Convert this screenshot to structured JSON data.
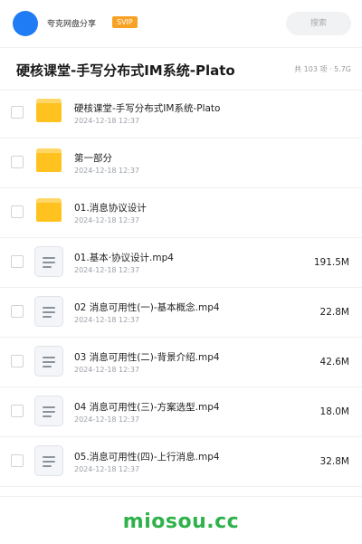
{
  "header": {
    "owner": "夸克网盘分享",
    "badge": "SVIP",
    "search_placeholder": "搜索"
  },
  "folder": {
    "title": "硬核课堂-手写分布式IM系统-Plato",
    "meta": "共 103 项 · 5.7G"
  },
  "items": [
    {
      "type": "folder",
      "name": "硬核课堂-手写分布式IM系统-Plato",
      "date": "2024-12-18 12:37",
      "size": ""
    },
    {
      "type": "folder",
      "name": "第一部分",
      "date": "2024-12-18 12:37",
      "size": ""
    },
    {
      "type": "folder",
      "name": "01.消息协议设计",
      "date": "2024-12-18 12:37",
      "size": ""
    },
    {
      "type": "file",
      "name": "01.基本·协议设计.mp4",
      "date": "2024-12-18 12:37",
      "size": "191.5M"
    },
    {
      "type": "file",
      "name": "02 消息可用性(一)-基本概念.mp4",
      "date": "2024-12-18 12:37",
      "size": "22.8M"
    },
    {
      "type": "file",
      "name": "03 消息可用性(二)-背景介绍.mp4",
      "date": "2024-12-18 12:37",
      "size": "42.6M"
    },
    {
      "type": "file",
      "name": "04 消息可用性(三)-方案选型.mp4",
      "date": "2024-12-18 12:37",
      "size": "18.0M"
    },
    {
      "type": "file",
      "name": "05.消息可用性(四)-上行消息.mp4",
      "date": "2024-12-18 12:37",
      "size": "32.8M"
    }
  ],
  "watermark": "miosou.cc",
  "colors": {
    "accent": "#1f7cf5",
    "badge": "#f8a225",
    "folder": "#ffc21e",
    "watermark": "#2fb24b"
  }
}
